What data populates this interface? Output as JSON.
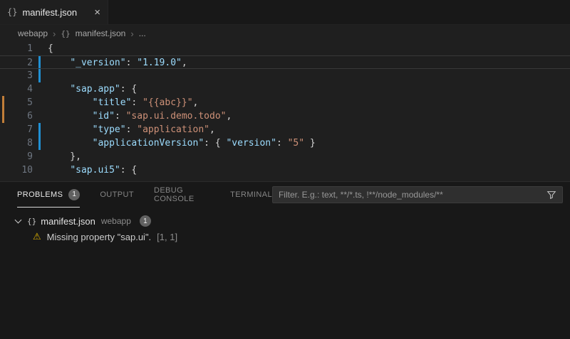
{
  "palette": {
    "editor_bg": "#1f1f1f",
    "panel_bg": "#181818",
    "tabbar_bg": "#181818",
    "json_key": "#9cdcfe",
    "json_string": "#ce9178",
    "punctuation": "#d4d4d4",
    "line_number": "#6e7681",
    "modified_marker": "#2090d3",
    "warning_marker": "#c27e38",
    "warning_icon": "#ddb100",
    "badge_bg": "#616161"
  },
  "tab": {
    "icon": "{}",
    "title": "manifest.json",
    "close": "×"
  },
  "breadcrumb": {
    "items": [
      "webapp",
      "manifest.json",
      "..."
    ],
    "separator": "›",
    "icon": "{}"
  },
  "editor": {
    "lines": [
      {
        "num": "1",
        "tokens": [
          {
            "t": "{",
            "c": "punct"
          }
        ]
      },
      {
        "num": "2",
        "modified": true,
        "current": true,
        "tokens": [
          {
            "t": "    ",
            "c": "punct"
          },
          {
            "t": "\"_version\"",
            "c": "key"
          },
          {
            "t": ": ",
            "c": "punct"
          },
          {
            "t": "\"1.19.0\"",
            "c": "strblue"
          },
          {
            "t": ",",
            "c": "punct"
          }
        ]
      },
      {
        "num": "3",
        "modified": true,
        "tokens": []
      },
      {
        "num": "4",
        "tokens": [
          {
            "t": "    ",
            "c": "punct"
          },
          {
            "t": "\"sap.app\"",
            "c": "key"
          },
          {
            "t": ": {",
            "c": "punct"
          }
        ]
      },
      {
        "num": "5",
        "warn": true,
        "tokens": [
          {
            "t": "        ",
            "c": "punct"
          },
          {
            "t": "\"title\"",
            "c": "key"
          },
          {
            "t": ": ",
            "c": "punct"
          },
          {
            "t": "\"{{abc}}\"",
            "c": "str"
          },
          {
            "t": ",",
            "c": "punct"
          }
        ]
      },
      {
        "num": "6",
        "warn": true,
        "tokens": [
          {
            "t": "        ",
            "c": "punct"
          },
          {
            "t": "\"id\"",
            "c": "key"
          },
          {
            "t": ": ",
            "c": "punct"
          },
          {
            "t": "\"sap.ui.demo.todo\"",
            "c": "str"
          },
          {
            "t": ",",
            "c": "punct"
          }
        ]
      },
      {
        "num": "7",
        "modified": true,
        "tokens": [
          {
            "t": "        ",
            "c": "punct"
          },
          {
            "t": "\"type\"",
            "c": "key"
          },
          {
            "t": ": ",
            "c": "punct"
          },
          {
            "t": "\"application\"",
            "c": "str"
          },
          {
            "t": ",",
            "c": "punct"
          }
        ]
      },
      {
        "num": "8",
        "modified": true,
        "tokens": [
          {
            "t": "        ",
            "c": "punct"
          },
          {
            "t": "\"applicationVersion\"",
            "c": "key"
          },
          {
            "t": ": { ",
            "c": "punct"
          },
          {
            "t": "\"version\"",
            "c": "key"
          },
          {
            "t": ": ",
            "c": "punct"
          },
          {
            "t": "\"5\"",
            "c": "str"
          },
          {
            "t": " }",
            "c": "punct"
          }
        ]
      },
      {
        "num": "9",
        "tokens": [
          {
            "t": "    },",
            "c": "punct"
          }
        ]
      },
      {
        "num": "10",
        "tokens": [
          {
            "t": "    ",
            "c": "punct"
          },
          {
            "t": "\"sap.ui5\"",
            "c": "key"
          },
          {
            "t": ": {",
            "c": "punct"
          }
        ]
      }
    ]
  },
  "panel": {
    "tabs": [
      {
        "label": "PROBLEMS",
        "badge": "1",
        "active": true
      },
      {
        "label": "OUTPUT"
      },
      {
        "label": "DEBUG CONSOLE"
      },
      {
        "label": "TERMINAL"
      }
    ],
    "filter_placeholder": "Filter. E.g.: text, **/*.ts, !**/node_modules/**",
    "problems": {
      "file": {
        "icon": "{}",
        "name": "manifest.json",
        "path": "webapp",
        "count": "1"
      },
      "items": [
        {
          "icon": "⚠",
          "message": "Missing property \"sap.ui\".",
          "location": "[1, 1]"
        }
      ]
    }
  }
}
